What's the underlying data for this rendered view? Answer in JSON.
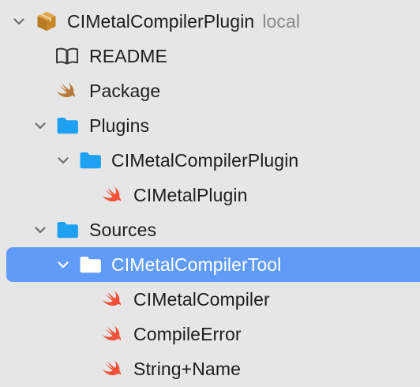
{
  "colors": {
    "background": "#e6e6e6",
    "selection": "#609cf7",
    "folder": "#1ea1f2",
    "swift": "#f05138",
    "package_swift": "#b5793a",
    "package_box": "#c9892b"
  },
  "navigator": {
    "project": {
      "name": "CIMetalCompilerPlugin",
      "badge": "local",
      "icon": "package-box-icon"
    },
    "items": [
      {
        "label": "README",
        "icon": "book-icon"
      },
      {
        "label": "Package",
        "icon": "swift-package-icon"
      },
      {
        "label": "Plugins",
        "icon": "folder-icon"
      },
      {
        "label": "CIMetalCompilerPlugin",
        "icon": "folder-icon"
      },
      {
        "label": "CIMetalPlugin",
        "icon": "swift-file-icon"
      },
      {
        "label": "Sources",
        "icon": "folder-icon"
      },
      {
        "label": "CIMetalCompilerTool",
        "icon": "folder-icon",
        "selected": true
      },
      {
        "label": "CIMetalCompiler",
        "icon": "swift-file-icon"
      },
      {
        "label": "CompileError",
        "icon": "swift-file-icon"
      },
      {
        "label": "String+Name",
        "icon": "swift-file-icon"
      }
    ]
  }
}
